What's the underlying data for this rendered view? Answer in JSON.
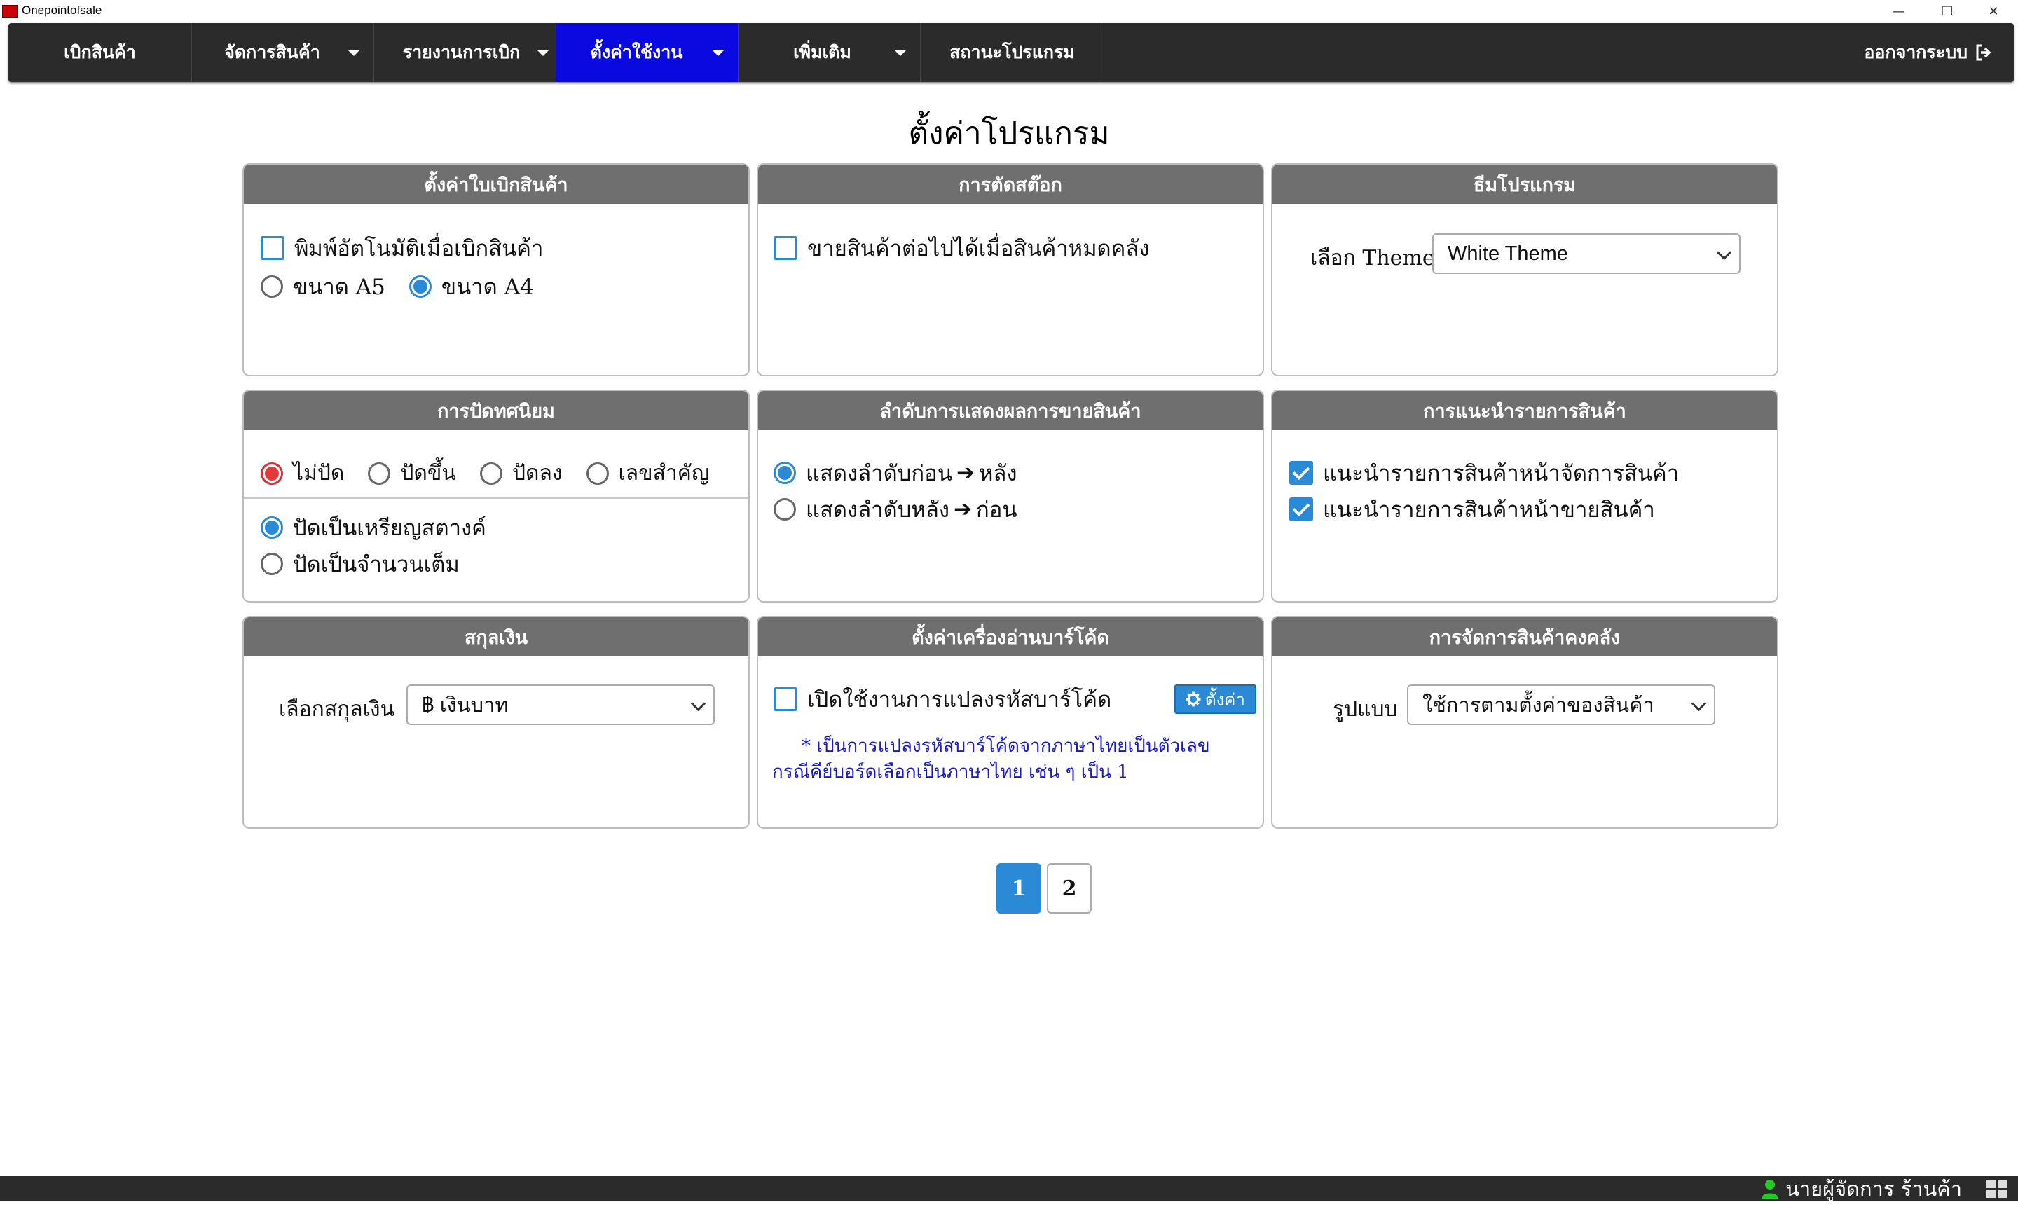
{
  "window": {
    "title": "Onepointofsale",
    "minimize": "—",
    "restore": "❐",
    "close": "✕"
  },
  "nav": {
    "items": [
      {
        "label": "เบิกสินค้า",
        "has_caret": false,
        "active": false
      },
      {
        "label": "จัดการสินค้า",
        "has_caret": true,
        "active": false
      },
      {
        "label": "รายงานการเบิก",
        "has_caret": true,
        "active": false
      },
      {
        "label": "ตั้งค่าใช้งาน",
        "has_caret": true,
        "active": true
      },
      {
        "label": "เพิ่มเติม",
        "has_caret": true,
        "active": false
      },
      {
        "label": "สถานะโปรแกรม",
        "has_caret": false,
        "active": false
      }
    ],
    "logout_label": "ออกจากระบบ",
    "logout_icon": "logout-icon",
    "active_color": "#0a0ae0"
  },
  "page_title": "ตั้งค่าโปรแกรม",
  "panels": {
    "requisition": {
      "title": "ตั้งค่าใบเบิกสินค้า",
      "auto_print_label": "พิมพ์อัตโนมัติเมื่อเบิกสินค้า",
      "auto_print_checked": false,
      "size_a5_label": "ขนาด A5",
      "size_a4_label": "ขนาด A4",
      "selected_size": "A4"
    },
    "stock_cut": {
      "title": "การตัดสต๊อก",
      "sell_out_of_stock_label": "ขายสินค้าต่อไปได้เมื่อสินค้าหมดคลัง",
      "sell_out_of_stock_checked": false
    },
    "theme": {
      "title": "ธีมโปรแกรม",
      "select_label": "เลือก Theme",
      "selected": "White Theme"
    },
    "rounding": {
      "title": "การปัดทศนิยม",
      "options": [
        "ไม่ปัด",
        "ปัดขึ้น",
        "ปัดลง",
        "เลขสำคัญ"
      ],
      "selected_option": "ไม่ปัด",
      "coin_label": "ปัดเป็นเหรียญสตางค์",
      "integer_label": "ปัดเป็นจำนวนเต็ม",
      "selected_mode": "ปัดเป็นเหรียญสตางค์"
    },
    "sales_order": {
      "title": "ลำดับการแสดงผลการขายสินค้า",
      "first_a": "แสดงลำดับก่อน",
      "first_b": "หลัง",
      "second_a": "แสดงลำดับหลัง",
      "second_b": "ก่อน",
      "arrow": "➔",
      "selected": "first"
    },
    "suggest": {
      "title": "การแนะนำรายการสินค้า",
      "manage_label": "แนะนำรายการสินค้าหน้าจัดการสินค้า",
      "manage_checked": true,
      "sell_label": "แนะนำรายการสินค้าหน้าขายสินค้า",
      "sell_checked": true
    },
    "currency": {
      "title": "สกุลเงิน",
      "select_label": "เลือกสกุลเงิน",
      "selected": "฿ เงินบาท"
    },
    "barcode": {
      "title": "ตั้งค่าเครื่องอ่านบาร์โค้ด",
      "enable_label": "เปิดใช้งานการแปลงรหัสบาร์โค้ด",
      "enable_checked": false,
      "setup_button": "ตั้งค่า",
      "note_line1": "* เป็นการแปลงรหัสบาร์โค้ดจากภาษาไทยเป็นตัวเลข",
      "note_line2": "กรณีคีย์บอร์ดเลือกเป็นภาษาไทย เช่น ๆ เป็น 1"
    },
    "inventory": {
      "title": "การจัดการสินค้าคงคลัง",
      "select_label": "รูปแบบ",
      "selected": "ใช้การตามตั้งค่าของสินค้า"
    }
  },
  "pagination": {
    "pages": [
      "1",
      "2"
    ],
    "current": "1"
  },
  "status": {
    "user_label": "นายผู้จัดการ ร้านค้า",
    "user_icon": "user-icon",
    "online_color": "#22cc22"
  }
}
